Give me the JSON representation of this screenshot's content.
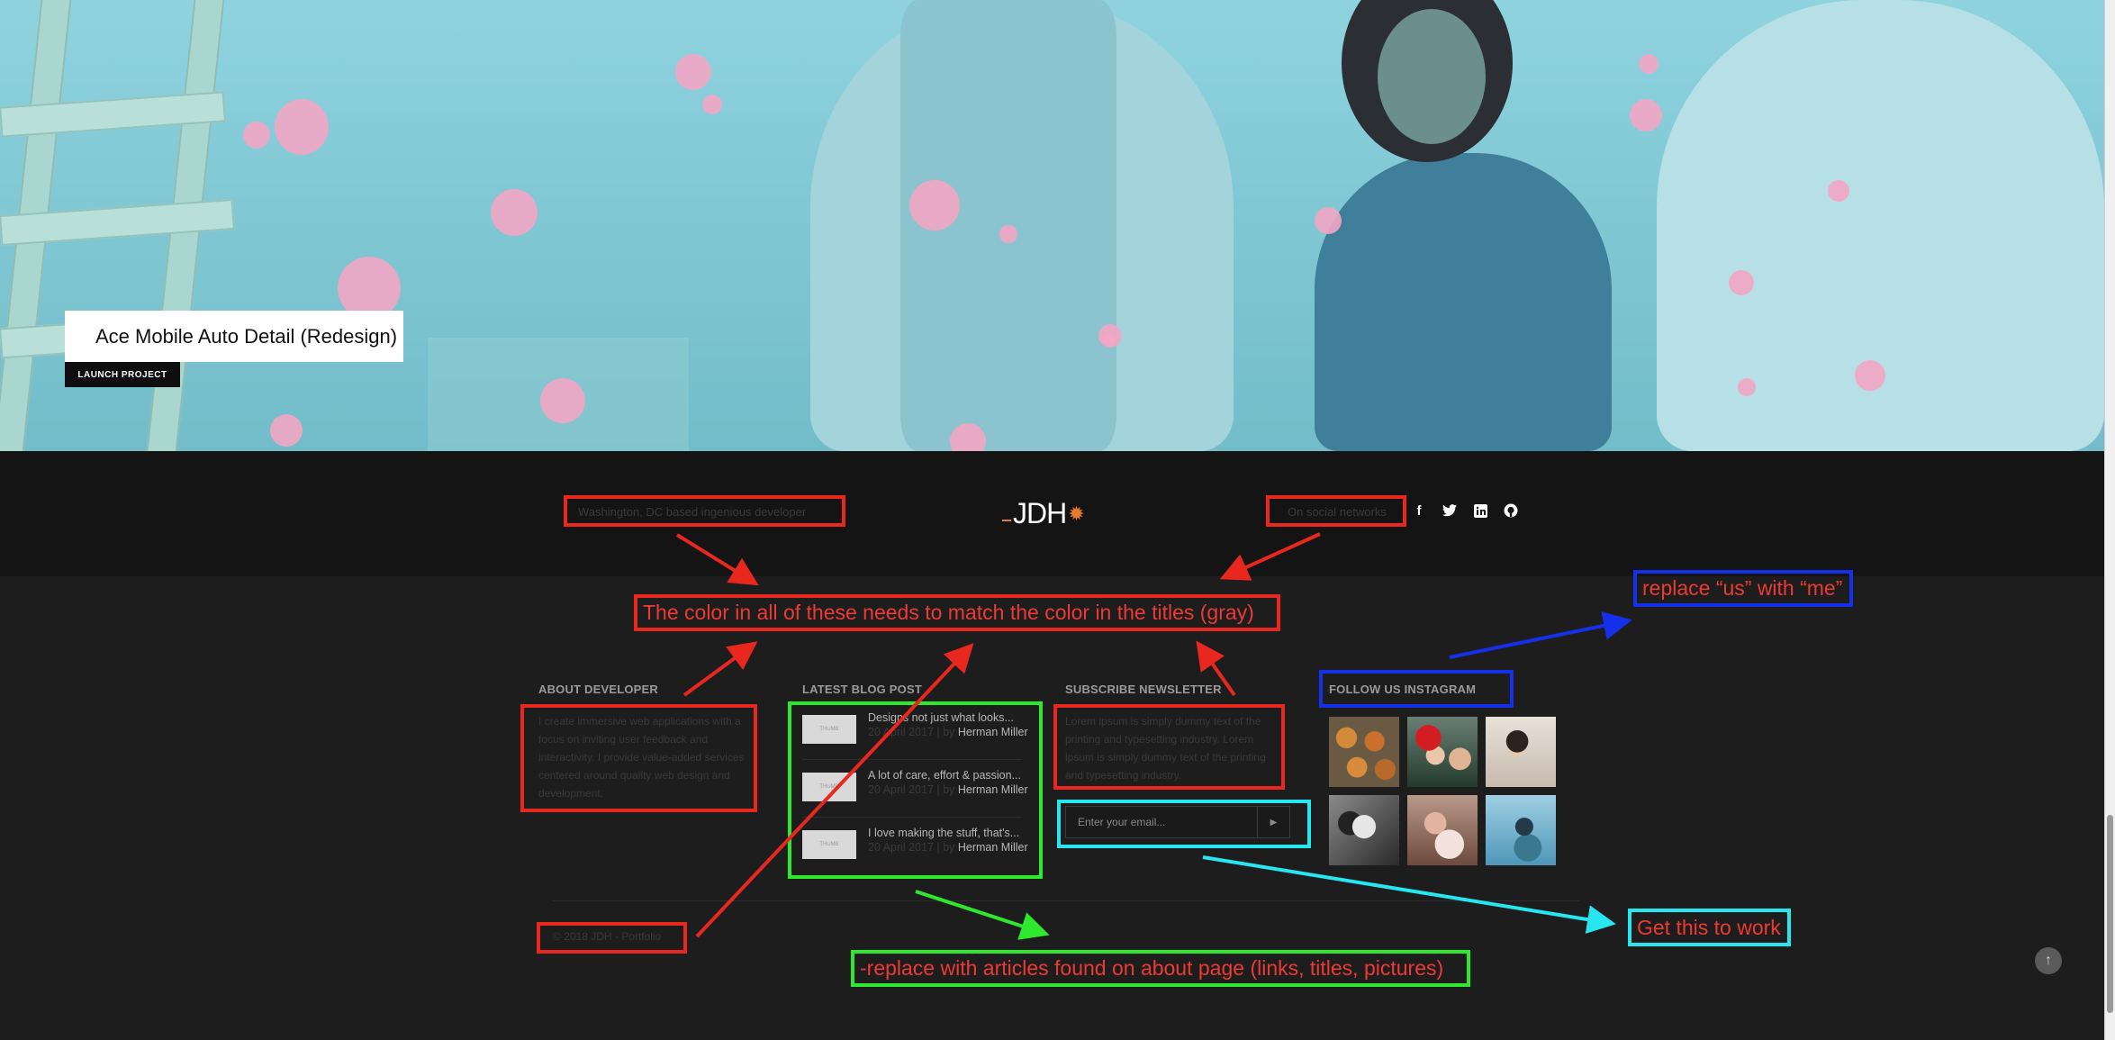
{
  "hero": {
    "project_title": "Ace Mobile Auto Detail (Redesign)",
    "launch_label": "LAUNCH PROJECT"
  },
  "footer_top": {
    "tagline": "Washington, DC based ingenious developer",
    "logo_text": "JDH",
    "social_label": "On social networks",
    "socials": [
      {
        "icon": "facebook-icon",
        "glyph": "f"
      },
      {
        "icon": "twitter-icon",
        "glyph": "t"
      },
      {
        "icon": "linkedin-icon",
        "glyph": "in"
      },
      {
        "icon": "github-icon",
        "glyph": "gh"
      }
    ]
  },
  "about": {
    "title": "ABOUT DEVELOPER",
    "text": "I create immersive web applications with a focus on inviting user feedback and interactivity. I provide value-added services centered around quality web design and development."
  },
  "blog": {
    "title": "LATEST BLOG POST",
    "thumb_label": "THUMB",
    "posts": [
      {
        "title": "Designs not just what looks...",
        "date": "20 April 2017",
        "by": "by",
        "author": "Herman Miller"
      },
      {
        "title": "A lot of care, effort & passion...",
        "date": "20 April 2017",
        "by": "by",
        "author": "Herman Miller"
      },
      {
        "title": "I love making the stuff, that's...",
        "date": "20 April 2017",
        "by": "by",
        "author": "Herman Miller"
      }
    ]
  },
  "subscribe": {
    "title": "SUBSCRIBE NEWSLETTER",
    "text": "Lorem ipsum is simply dummy text of the printing and typesetting industry. Lorem ipsum is simply dummy text of the printing and typesetting industry.",
    "placeholder": "Enter your email...",
    "send_glyph": "▶"
  },
  "instagram": {
    "title": "FOLLOW US INSTAGRAM"
  },
  "copyright": "© 2018 JDH - Portfolio",
  "back_to_top_glyph": "↑",
  "annotations": {
    "gray_note": "The color in all of these needs to match the color in the titles (gray)",
    "me_note": "replace “us” with “me”",
    "work_note": "Get this to work",
    "articles_note": "-replace with articles found on about page (links, titles, pictures)"
  },
  "colors": {
    "annotation_red": "#e8271f",
    "annotation_blue": "#1530e8",
    "annotation_green": "#2ee82e",
    "annotation_cyan": "#27e6f0",
    "footer_bg": "#1d1d1d",
    "title_gray": "#9a9a9a"
  }
}
